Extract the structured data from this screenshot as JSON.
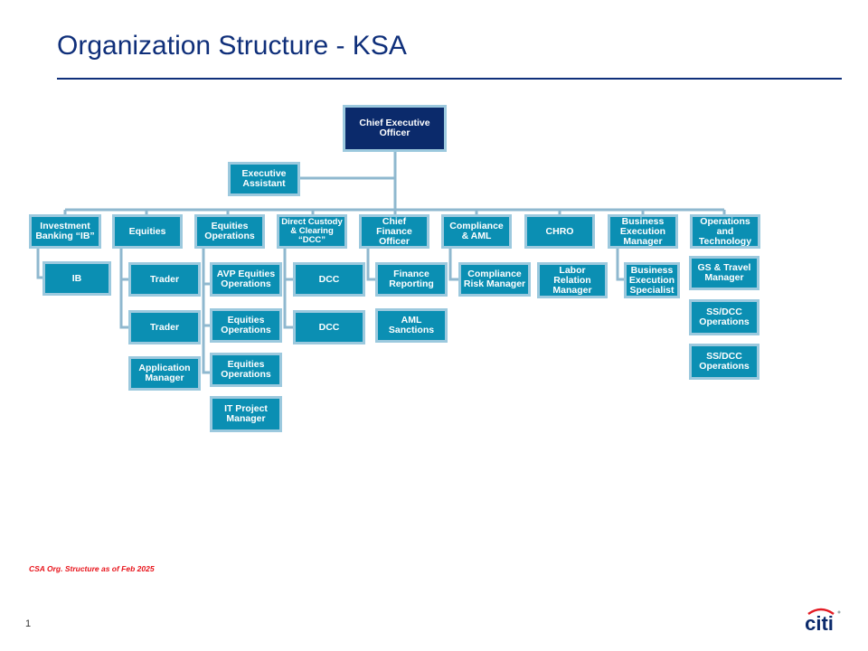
{
  "slide": {
    "title": "Organization Structure - KSA",
    "footnote": "CSA Org. Structure as of Feb 2025",
    "page_number": "1",
    "logo": {
      "text": "citi",
      "icon": "citi-logo-icon",
      "arc_color": "#e31b23",
      "text_color": "#0b2a6b"
    }
  },
  "colors": {
    "title": "#0f2f7a",
    "box_fill": "#0b8fb3",
    "box_border": "#9cc9de",
    "ceo_fill": "#0b2a6b",
    "connector": "#8fb8cf",
    "footnote": "#e8141b"
  },
  "org": {
    "ceo": "Chief Executive Officer",
    "assistant": "Executive Assistant",
    "departments": [
      {
        "label": "Investment Banking “IB”",
        "children": [
          "IB"
        ]
      },
      {
        "label": "Equities",
        "children": [
          "Trader",
          "Trader",
          "Application Manager"
        ]
      },
      {
        "label": "Equities Operations",
        "children": [
          "AVP Equities Operations",
          "Equities Operations",
          "Equities Operations",
          "IT Project Manager"
        ]
      },
      {
        "label": "Direct Custody & Clearing “DCC”",
        "children": [
          "DCC",
          "DCC"
        ]
      },
      {
        "label": "Chief Finance Officer",
        "children": [
          "Finance Reporting",
          "AML Sanctions"
        ]
      },
      {
        "label": "Compliance & AML",
        "children": [
          "Compliance Risk Manager"
        ]
      },
      {
        "label": "CHRO",
        "children": [
          "Labor Relation Manager"
        ]
      },
      {
        "label": "Business Execution Manager",
        "children": [
          "Business Execution Specialist"
        ]
      },
      {
        "label": "Operations and Technology",
        "children": [
          "GS & Travel Manager",
          "SS/DCC Operations",
          "SS/DCC Operations"
        ]
      }
    ]
  }
}
